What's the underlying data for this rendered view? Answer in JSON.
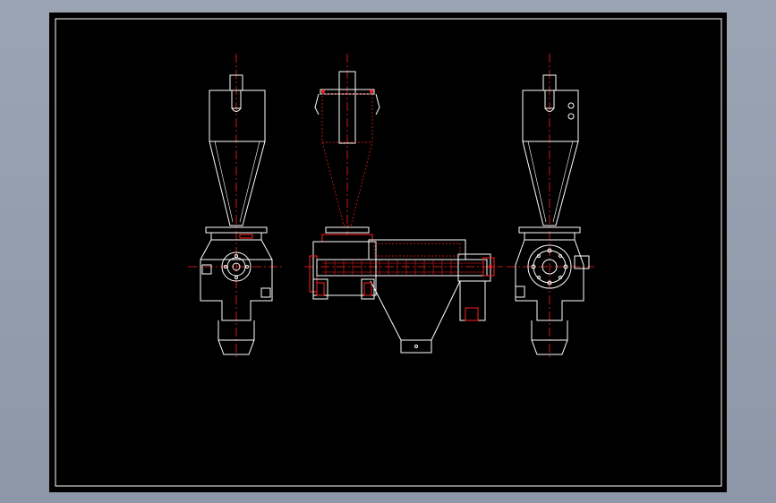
{
  "drawing": {
    "background_color": "#000000",
    "line_color": "#ffffff",
    "accent_color": "#ff2020",
    "centerline_color": "#ff2020",
    "views": [
      {
        "id": "left-view"
      },
      {
        "id": "front-section-view"
      },
      {
        "id": "right-view"
      }
    ]
  }
}
